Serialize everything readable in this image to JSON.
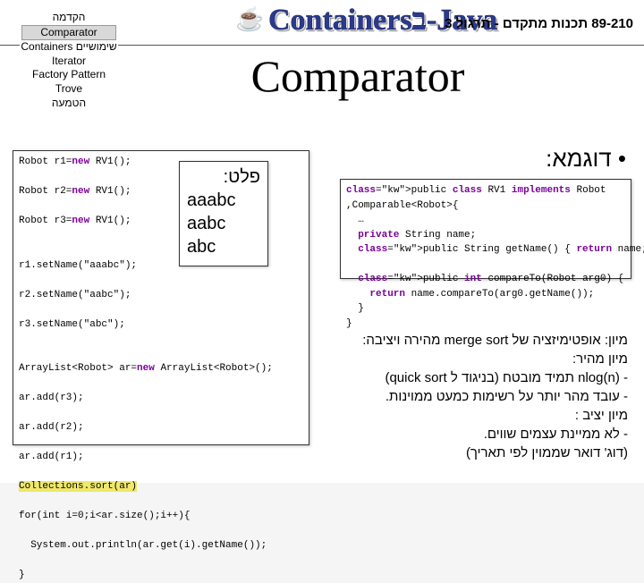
{
  "header": {
    "fancy_title": "Containersב-Java",
    "course": "89-210 תכנות מתקדם - תרגול 3"
  },
  "nav": {
    "items": [
      "הקדמה",
      "Comparator",
      "שימושיים Containers",
      "Iterator",
      "Factory Pattern",
      "Trove",
      "הטמעה"
    ],
    "selected_index": 1
  },
  "main_title": "Comparator",
  "bullet": "• דוגמא:",
  "output": {
    "label": "פלט:",
    "lines": [
      "aaabc",
      "aabc",
      "abc"
    ]
  },
  "code_left": "Robot r1=new RV1();\n\nRobot r2=new RV1();\n\nRobot r3=new RV1();\n\n\nr1.setName(\"aaabc\");\n\nr2.setName(\"aabc\");\n\nr3.setName(\"abc\");\n\n\nArrayList<Robot> ar=new ArrayList<Robot>();\n\nar.add(r3);\n\nar.add(r2);\n\nar.add(r1);\n\nCollections.sort(ar)\n\nfor(int i=0;i<ar.size();i++){\n\n  System.out.println(ar.get(i).getName());\n\n}",
  "code_right_plain": "public class RV1 implements Robot\n,Comparable<Robot>{\n  …\n  private String name;\n  public String getName() { return name; }\n\n  public int compareTo(Robot arg0) {\n    return name.compareTo(arg0.getName());\n  }\n}",
  "code_right_kw": [
    "public",
    "class",
    "implements",
    "private",
    "return",
    "int"
  ],
  "notes_lines": [
    "מיון: אופטימיזציה של merge sort מהירה ויציבה:",
    "מיון מהיר:",
    "- nlog(n) תמיד מובטח (בניגוד ל quick sort)",
    "- עובד מהר יותר על רשימות כמעט ממוינות.",
    "מיון יציב :",
    "- לא ממיינת עצמים שווים.",
    "(דוג' דואר שממוין לפי תאריך)"
  ],
  "highlight_line": "Collections.sort(ar)"
}
